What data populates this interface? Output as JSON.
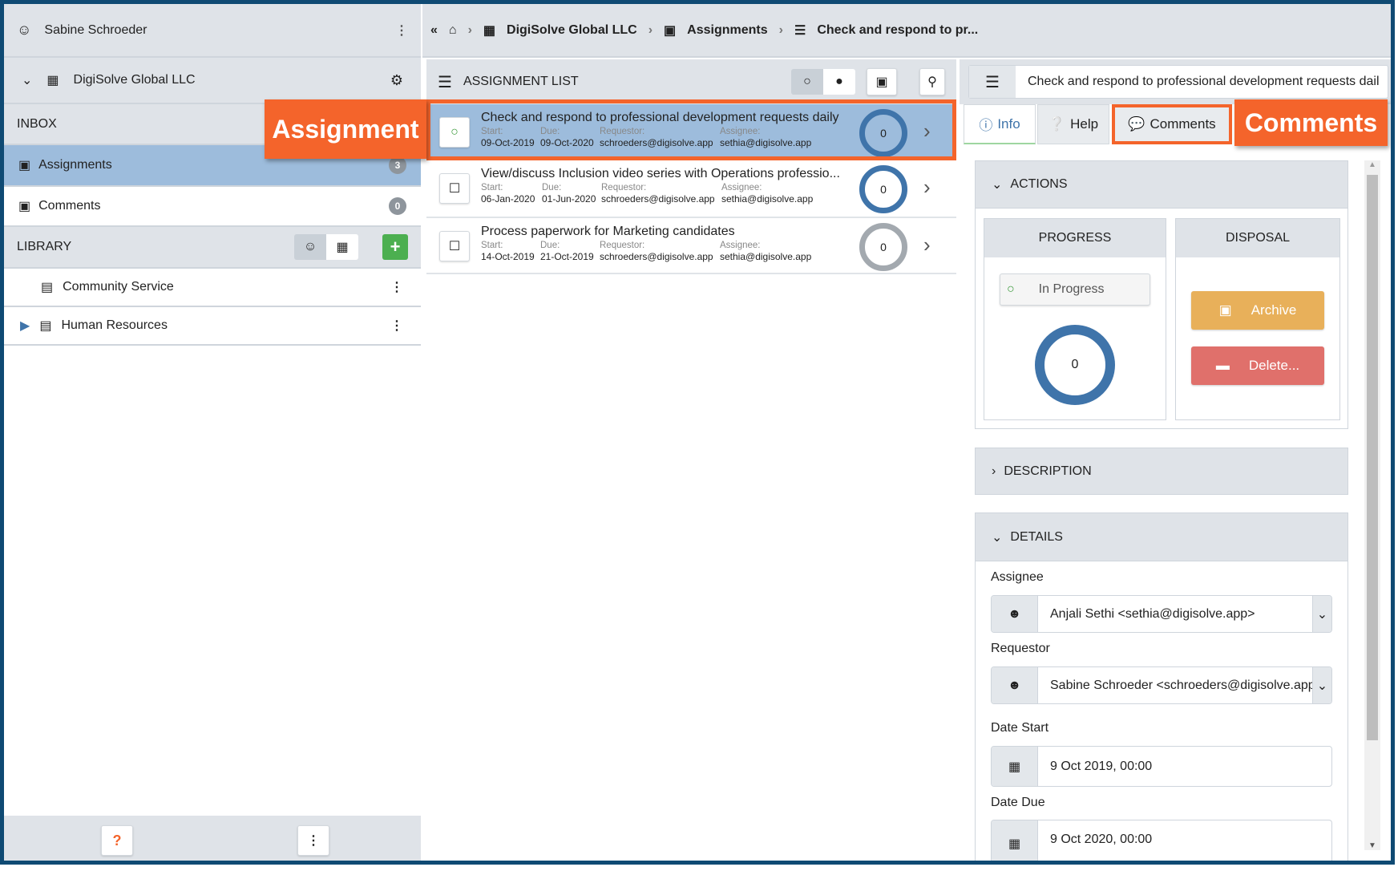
{
  "user": {
    "name": "Sabine Schroeder"
  },
  "org": {
    "name": "DigiSolve Global LLC"
  },
  "inbox": {
    "title": "INBOX",
    "items": [
      {
        "label": "Assignments",
        "count": "3"
      },
      {
        "label": "Comments",
        "count": "0"
      }
    ]
  },
  "library": {
    "title": "LIBRARY",
    "items": [
      {
        "label": "Community Service"
      },
      {
        "label": "Human Resources"
      }
    ]
  },
  "breadcrumb": [
    "DigiSolve Global LLC",
    "Assignments",
    "Check and respond to pr..."
  ],
  "list": {
    "title": "ASSIGNMENT LIST",
    "labels": {
      "start": "Start:",
      "due": "Due:",
      "requestor": "Requestor:",
      "assignee": "Assignee:"
    },
    "items": [
      {
        "title": "Check and respond to professional development requests daily",
        "start": "09-Oct-2019",
        "due": "09-Oct-2020",
        "requestor": "schroeders@digisolve.app",
        "assignee": "sethia@digisolve.app",
        "count": "0"
      },
      {
        "title": "View/discuss Inclusion video series with Operations professio...",
        "start": "06-Jan-2020",
        "due": "01-Jun-2020",
        "requestor": "schroeders@digisolve.app",
        "assignee": "sethia@digisolve.app",
        "count": "0"
      },
      {
        "title": "Process paperwork for Marketing candidates",
        "start": "14-Oct-2019",
        "due": "21-Oct-2019",
        "requestor": "schroeders@digisolve.app",
        "assignee": "sethia@digisolve.app",
        "count": "0"
      }
    ]
  },
  "detail": {
    "title": "Check and respond to professional development requests dail",
    "tabs": [
      "Info",
      "Help",
      "Comments"
    ],
    "actions": "ACTIONS",
    "progress": "PROGRESS",
    "disposal": "DISPOSAL",
    "status": "In Progress",
    "count": "0",
    "archive": "Archive",
    "delete": "Delete...",
    "description": "DESCRIPTION",
    "details": "DETAILS",
    "fields": {
      "assignee_label": "Assignee",
      "assignee": "Anjali Sethi <sethia@digisolve.app>",
      "requestor_label": "Requestor",
      "requestor": "Sabine Schroeder <schroeders@digisolve.app>",
      "start_label": "Date Start",
      "start": "9 Oct 2019, 00:00",
      "due_label": "Date Due",
      "due": "9 Oct 2020, 00:00"
    }
  },
  "annotations": {
    "assignment": "Assignment",
    "comments": "Comments"
  },
  "colors": {
    "accent": "#3f74aa",
    "annotation": "#f4642b",
    "selected": "#9dbcdc",
    "archive": "#e8b05a",
    "delete": "#e0706b"
  }
}
